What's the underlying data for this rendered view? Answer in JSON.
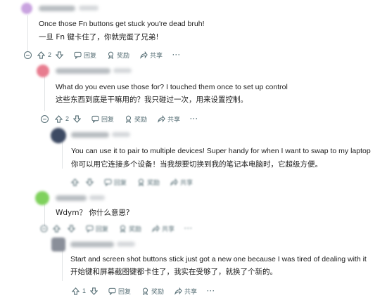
{
  "comments": [
    {
      "id": "c1",
      "text_en": "Once those Fn buttons get stuck you're dead bruh!",
      "text_zh": "一旦 Fn 键卡住了，你就完蛋了兄弟!",
      "votes": "2",
      "reply_label": "回复",
      "award_label": "奖励",
      "share_label": "共享",
      "more_label": "···"
    },
    {
      "id": "c2",
      "text_en": "What do you even use those for? I touched them once to set up control",
      "text_zh": "这些东西到底是干嘛用的？我只碰过一次，用来设置控制。",
      "votes": "2",
      "reply_label": "回复",
      "award_label": "奖励",
      "share_label": "共享",
      "more_label": "···"
    },
    {
      "id": "c3",
      "text_en": "You can use it to pair to multiple devices! Super handy for when I want to swap to my laptop",
      "text_zh": "你可以用它连接多个设备！当我想要切换到我的笔记本电脑时，它超级方便。",
      "votes": "",
      "reply_label": "回复",
      "award_label": "奖励",
      "share_label": "共享",
      "more_label": ""
    },
    {
      "id": "c4",
      "text_en": "Wdym？ 你什么意思?",
      "text_zh": "",
      "votes": "",
      "reply_label": "回复",
      "award_label": "奖励",
      "share_label": "共享",
      "more_label": "···"
    },
    {
      "id": "c5",
      "text_en": "Start and screen shot buttons stick just got a new one because I was tired of dealing with it",
      "text_zh": "开始键和屏幕截图键都卡住了，我实在受够了，就换了个新的。",
      "votes": "1",
      "reply_label": "回复",
      "award_label": "奖励",
      "share_label": "共享",
      "more_label": "···"
    }
  ],
  "colors": {
    "avatar1": "#c9a3e0",
    "avatar2": "#e87c8f",
    "avatar3": "#3d4a63",
    "avatar4": "#7fd15c",
    "avatar5": "#8a8f99",
    "action_gray": "#576f76",
    "thread_line": "#e2e4e6"
  },
  "icons": [
    "upvote-icon",
    "downvote-icon",
    "reply-icon",
    "award-icon",
    "share-icon",
    "collapse-icon"
  ]
}
